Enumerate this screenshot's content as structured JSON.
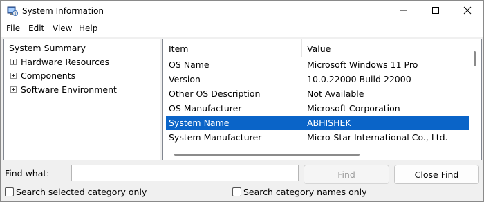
{
  "window": {
    "title": "System Information",
    "icon": "system-info-icon",
    "caption_buttons": [
      "minimize-icon",
      "maximize-icon",
      "close-icon"
    ]
  },
  "menu": {
    "file": "File",
    "edit": "Edit",
    "view": "View",
    "help": "Help"
  },
  "tree": {
    "root": "System Summary",
    "children": [
      "Hardware Resources",
      "Components",
      "Software Environment"
    ]
  },
  "list": {
    "columns": [
      "Item",
      "Value"
    ],
    "rows": [
      {
        "item": "OS Name",
        "value": "Microsoft Windows 11 Pro"
      },
      {
        "item": "Version",
        "value": "10.0.22000 Build 22000"
      },
      {
        "item": "Other OS Description",
        "value": "Not Available"
      },
      {
        "item": "OS Manufacturer",
        "value": "Microsoft Corporation"
      },
      {
        "item": "System Name",
        "value": "ABHISHEK"
      },
      {
        "item": "System Manufacturer",
        "value": "Micro-Star International Co., Ltd."
      }
    ],
    "selected_index": 4
  },
  "find": {
    "label": "Find what:",
    "value": "",
    "find_button": "Find",
    "close_find_button": "Close Find",
    "search_selected_label": "Search selected category only",
    "search_names_label": "Search category names only"
  },
  "colors": {
    "selection": "#0a64c8",
    "window_bg": "#f0f0f0"
  }
}
